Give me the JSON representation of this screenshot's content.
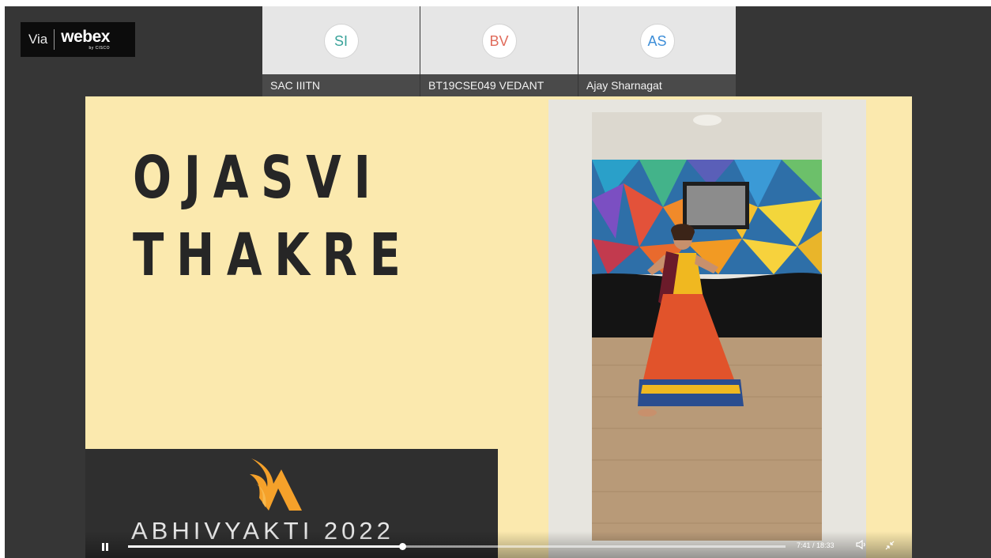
{
  "webex_badge": {
    "via": "Via",
    "name": "webex",
    "by": "by CISCO"
  },
  "participants": [
    {
      "initials": "SI",
      "name": "SAC IIITN",
      "color": "#3aa39a"
    },
    {
      "initials": "BV",
      "name": "BT19CSE049 VEDANT",
      "color": "#e06b5b"
    },
    {
      "initials": "AS",
      "name": "Ajay Sharnagat",
      "color": "#3d8ed8"
    }
  ],
  "slide": {
    "performer_line1": "OJASVI",
    "performer_line2": "THAKRE",
    "event_title": "ABHIVYAKTI 2022",
    "logo_icon": "abhivyakti-flame-logo",
    "logo_color": "#f5a12a"
  },
  "player": {
    "state_icon": "pause-icon",
    "progress": 0.417,
    "time": "7:41 / 18:33",
    "volume_icon": "volume-icon",
    "fullscreen_icon": "exit-fullscreen-icon"
  }
}
